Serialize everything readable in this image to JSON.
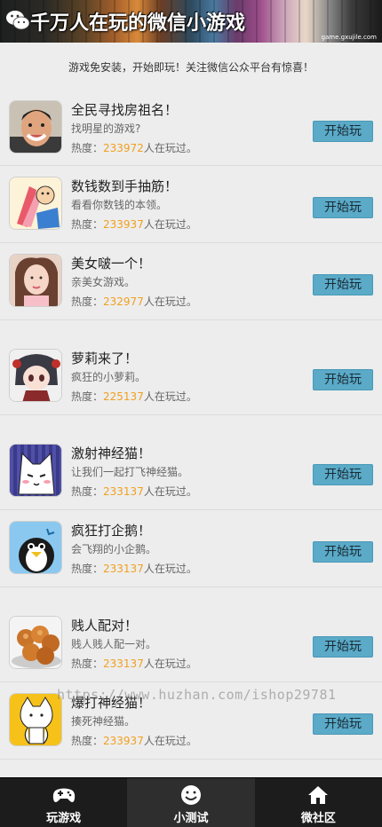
{
  "header": {
    "title": "千万人在玩的微信小游戏",
    "site": "game.gxujile.com"
  },
  "notice": "游戏免安装，开始即玩！关注微信公众平台有惊喜！",
  "heat_prefix": "热度：",
  "heat_suffix": "人在玩过。",
  "play_label": "开始玩",
  "games": [
    {
      "name": "全民寻找房祖名！",
      "desc": "找明星的游戏?",
      "heat": "233972"
    },
    {
      "name": "数钱数到手抽筋！",
      "desc": "看看你数钱的本领。",
      "heat": "233937"
    },
    {
      "name": "美女啵一个！",
      "desc": "亲美女游戏。",
      "heat": "232977"
    },
    {
      "name": "萝莉来了！",
      "desc": "疯狂的小萝莉。",
      "heat": "225137"
    },
    {
      "name": "激射神经猫！",
      "desc": "让我们一起打飞神经猫。",
      "heat": "233137"
    },
    {
      "name": "疯狂打企鹅！",
      "desc": "会飞翔的小企鹅。",
      "heat": "233137"
    },
    {
      "name": "贱人配对！",
      "desc": "贱人贱人配一对。",
      "heat": "233137"
    },
    {
      "name": "爆打神经猫！",
      "desc": "揍死神经猫。",
      "heat": "233937"
    }
  ],
  "watermark": "https://www.huzhan.com/ishop29781",
  "tabs": [
    {
      "label": "玩游戏",
      "icon": "gamepad-icon"
    },
    {
      "label": "小测试",
      "icon": "smiley-icon"
    },
    {
      "label": "微社区",
      "icon": "home-icon"
    }
  ]
}
